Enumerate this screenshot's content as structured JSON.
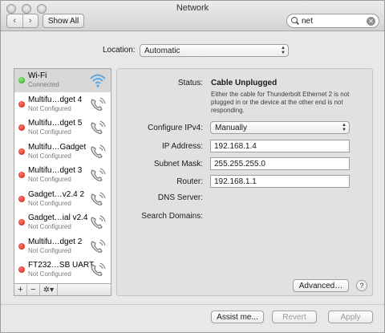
{
  "window": {
    "title": "Network"
  },
  "toolbar": {
    "back": "‹",
    "forward": "›",
    "show_all": "Show All"
  },
  "search": {
    "value": "net",
    "clear": "✕"
  },
  "location": {
    "label": "Location:",
    "value": "Automatic"
  },
  "sidebar": {
    "services": [
      {
        "name": "Wi-Fi",
        "status": "Connected",
        "dot": "green",
        "icon": "wifi-icon"
      },
      {
        "name": "Multifu…dget 4",
        "status": "Not Configured",
        "dot": "red",
        "icon": "phone-icon"
      },
      {
        "name": "Multifu…dget 5",
        "status": "Not Configured",
        "dot": "red",
        "icon": "phone-icon"
      },
      {
        "name": "Multifu…Gadget",
        "status": "Not Configured",
        "dot": "red",
        "icon": "phone-icon"
      },
      {
        "name": "Multifu…dget 3",
        "status": "Not Configured",
        "dot": "red",
        "icon": "phone-icon"
      },
      {
        "name": "Gadget…v2.4 2",
        "status": "Not Configured",
        "dot": "red",
        "icon": "phone-icon"
      },
      {
        "name": "Gadget…ial v2.4",
        "status": "Not Configured",
        "dot": "red",
        "icon": "phone-icon"
      },
      {
        "name": "Multifu…dget 2",
        "status": "Not Configured",
        "dot": "red",
        "icon": "phone-icon"
      },
      {
        "name": "FT232…SB UART",
        "status": "Not Configured",
        "dot": "red",
        "icon": "phone-icon"
      }
    ],
    "add": "+",
    "remove": "−",
    "action": "✲▾"
  },
  "detail": {
    "status_label": "Status:",
    "status_value": "Cable Unplugged",
    "status_desc": "Either the cable for Thunderbolt Ethernet 2 is not plugged in or the device at the other end is not responding.",
    "ipv4_label": "Configure IPv4:",
    "ipv4_value": "Manually",
    "ip_label": "IP Address:",
    "ip_value": "192.168.1.4",
    "mask_label": "Subnet Mask:",
    "mask_value": "255.255.255.0",
    "router_label": "Router:",
    "router_value": "192.168.1.1",
    "dns_label": "DNS Server:",
    "search_domains_label": "Search Domains:",
    "advanced": "Advanced…",
    "help": "?"
  },
  "footer": {
    "assist": "Assist me...",
    "revert": "Revert",
    "apply": "Apply"
  },
  "colors": {
    "connected": "#2f9c1f",
    "not_configured": "#c41d10",
    "wifi": "#5aa9e6"
  }
}
